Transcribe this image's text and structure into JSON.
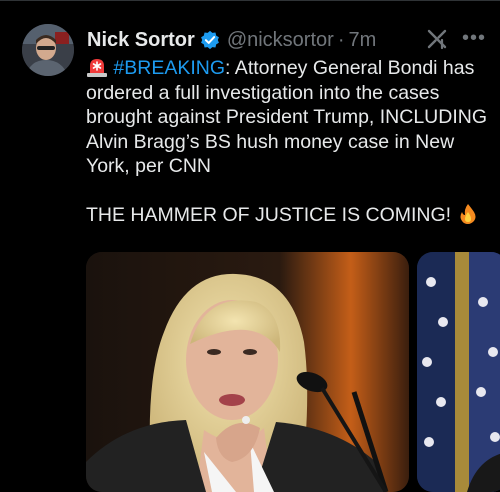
{
  "tweet": {
    "author_name": "Nick Sortor",
    "handle": "@nicksortor",
    "separator": "·",
    "time": "7m",
    "more_label": "•••",
    "hashtag": "#BREAKING",
    "line1_rest": ": Attorney General Bondi has ordered a full investigation into the cases brought against President Trump, INCLUDING Alvin Bragg’s BS hush money case in New York, per CNN",
    "line2": "THE HAMMER OF JUSTICE IS COMING! "
  },
  "icons": {
    "verified": "verified-badge-icon",
    "grok": "grok-icon",
    "more": "more-options-icon",
    "siren": "rotating-light-emoji",
    "fire": "fire-emoji"
  },
  "colors": {
    "background": "#000000",
    "text": "#e7e9ea",
    "secondary": "#71767b",
    "link": "#1d9bf0"
  }
}
